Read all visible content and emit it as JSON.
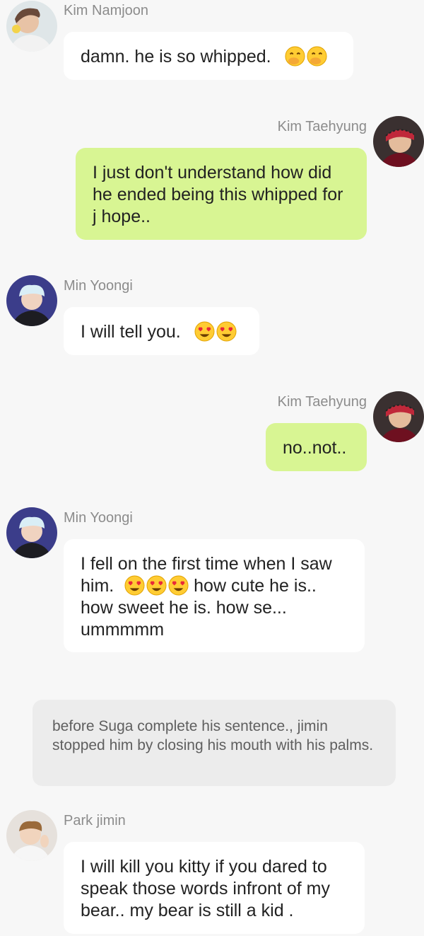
{
  "messages": [
    {
      "sender": "Kim Namjoon",
      "text": "damn. he is so whipped.",
      "emoji": [
        "hand-over-mouth-emoji",
        "hand-over-mouth-emoji"
      ]
    },
    {
      "sender": "Kim Taehyung",
      "text": "I just don't understand how did he ended being this whipped for j hope.."
    },
    {
      "sender": "Min Yoongi",
      "text": "I will tell you.",
      "emoji": [
        "heart-eyes-emoji",
        "heart-eyes-emoji"
      ]
    },
    {
      "sender": "Kim Taehyung",
      "text": "no..not.."
    },
    {
      "sender": "Min Yoongi",
      "text_before": "I fell on the first time when I saw him.",
      "text_after": "how cute he is.. how sweet he is.  how se... ummmmm",
      "emoji": [
        "heart-eyes-emoji",
        "heart-eyes-emoji",
        "heart-eyes-emoji"
      ]
    },
    {
      "narration": "before Suga complete his sentence., jimin stopped him by closing his mouth with his palms."
    },
    {
      "sender": "Park jimin",
      "text": "I will kill you kitty if you dared to speak those words infront of my bear.. my bear is still a kid ."
    }
  ],
  "colors": {
    "background": "#f7f7f7",
    "incoming_bubble": "#ffffff",
    "outgoing_bubble": "#d8f593",
    "narration_bubble": "#ececec",
    "sender_name": "#8c8c8c"
  }
}
